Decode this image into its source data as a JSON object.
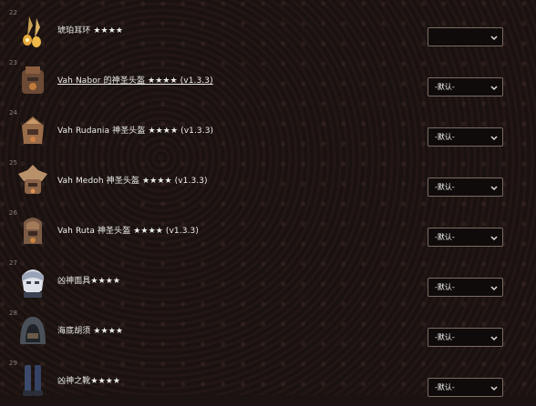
{
  "items": [
    {
      "num": "22",
      "name": "琥珀耳环 ★★★★",
      "select": "",
      "icon": "earring-icon",
      "link": false
    },
    {
      "num": "23",
      "name": "Vah Nabor 的神圣头盔 ★★★★ (v1.3.3)",
      "select": "-默认-",
      "icon": "helmet-icon",
      "link": true
    },
    {
      "num": "24",
      "name": "Vah Rudania 神圣头盔 ★★★★ (v1.3.3)",
      "select": "-默认-",
      "icon": "helmet-icon",
      "link": false
    },
    {
      "num": "25",
      "name": "Vah Medoh 神圣头盔 ★★★★ (v1.3.3)",
      "select": "-默认-",
      "icon": "helmet-icon",
      "link": false
    },
    {
      "num": "26",
      "name": "Vah Ruta 神圣头盔 ★★★★ (v1.3.3)",
      "select": "-默认-",
      "icon": "helmet-icon",
      "link": false
    },
    {
      "num": "27",
      "name": "凶神面具★★★★",
      "select": "-默认-",
      "icon": "mask-icon",
      "link": false
    },
    {
      "num": "28",
      "name": "海底胡须 ★★★★",
      "select": "-默认-",
      "icon": "hood-icon",
      "link": false
    },
    {
      "num": "29",
      "name": "凶神之靴★★★★",
      "select": "-默认-",
      "icon": "boots-icon",
      "link": false
    }
  ]
}
